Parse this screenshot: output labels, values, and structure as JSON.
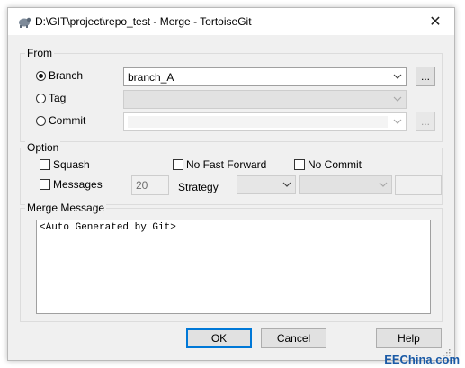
{
  "window": {
    "title": "D:\\GIT\\project\\repo_test - Merge - TortoiseGit",
    "close_glyph": "✕"
  },
  "from": {
    "label": "From",
    "branch": {
      "label": "Branch",
      "value": "branch_A",
      "checked": true
    },
    "tag": {
      "label": "Tag",
      "value": ""
    },
    "commit": {
      "label": "Commit",
      "value": ""
    },
    "browse_label": "..."
  },
  "option": {
    "label": "Option",
    "squash": "Squash",
    "no_fast_forward": "No Fast Forward",
    "no_commit": "No Commit",
    "messages": "Messages",
    "messages_value": "20",
    "strategy": "Strategy"
  },
  "merge_message": {
    "label": "Merge Message",
    "text": "<Auto Generated by Git>"
  },
  "buttons": {
    "ok": "OK",
    "cancel": "Cancel",
    "help": "Help"
  },
  "watermark": "EEChina.com",
  "colors": {
    "accent": "#0078d7",
    "dialog_bg": "#f0f0f0"
  }
}
